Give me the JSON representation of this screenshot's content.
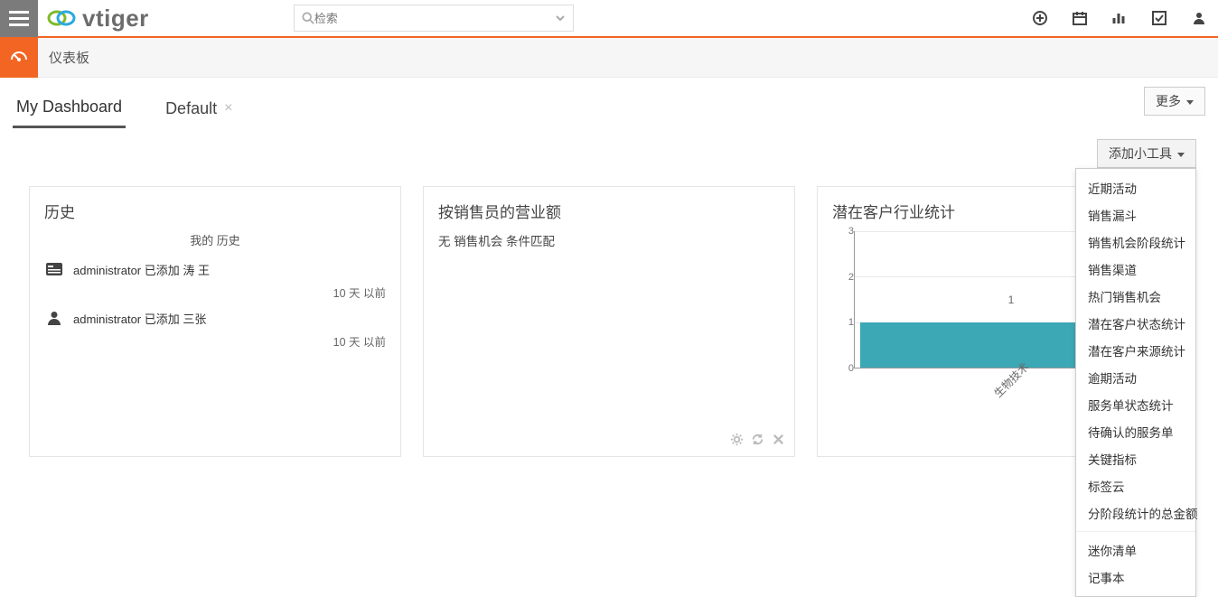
{
  "header": {
    "logo_text": "vtiger",
    "search_placeholder": "检索"
  },
  "subheader": {
    "title": "仪表板"
  },
  "tabs": {
    "items": [
      {
        "label": "My Dashboard",
        "active": true,
        "closable": false
      },
      {
        "label": "Default",
        "active": false,
        "closable": true
      }
    ],
    "more_label": "更多"
  },
  "toolbar": {
    "add_widget_label": "添加小工具"
  },
  "widget_menu": {
    "items": [
      "近期活动",
      "销售漏斗",
      "销售机会阶段统计",
      "销售渠道",
      "热门销售机会",
      "潜在客户状态统计",
      "潜在客户来源统计",
      "逾期活动",
      "服务单状态统计",
      "待确认的服务单",
      "关键指标",
      "标签云",
      "分阶段统计的总金额"
    ],
    "items2": [
      "迷你清单",
      "记事本"
    ]
  },
  "widgets": {
    "history": {
      "title": "历史",
      "subtitle": "我的 历史",
      "entries": [
        {
          "icon": "card",
          "text": "administrator 已添加 涛 王",
          "time": "10 天 以前"
        },
        {
          "icon": "user",
          "text": "administrator 已添加 三张",
          "time": "10 天 以前"
        }
      ]
    },
    "sales_by_rep": {
      "title": "按销售员的营业额",
      "empty": "无 销售机会 条件匹配"
    },
    "leads_by_industry": {
      "title": "潜在客户行业统计"
    }
  },
  "chart_data": {
    "type": "bar",
    "categories": [
      "生物技术"
    ],
    "values": [
      1
    ],
    "title": "潜在客户行业统计",
    "xlabel": "",
    "ylabel": "",
    "ylim": [
      0,
      3
    ],
    "yticks": [
      0,
      1,
      2,
      3
    ],
    "bar_color": "#3ca7b5"
  }
}
